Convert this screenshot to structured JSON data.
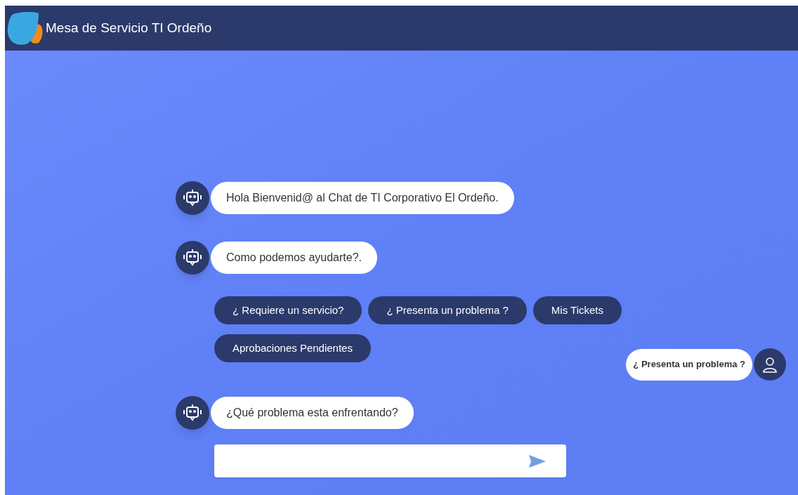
{
  "header": {
    "title": "Mesa de Servicio TI Ordeño"
  },
  "chat": [
    {
      "kind": "bot",
      "text": "Hola Bienvenid@ al Chat de TI Corporativo El Ordeño."
    },
    {
      "kind": "bot",
      "text": "Como podemos ayudarte?."
    },
    {
      "kind": "options",
      "options": [
        "¿ Requiere un servicio?",
        "¿ Presenta un problema ?",
        "Mis Tickets",
        "Aprobaciones Pendientes"
      ],
      "reply": "¿ Presenta un problema ?"
    },
    {
      "kind": "bot",
      "text": "¿Qué problema esta enfrentando?"
    }
  ]
}
